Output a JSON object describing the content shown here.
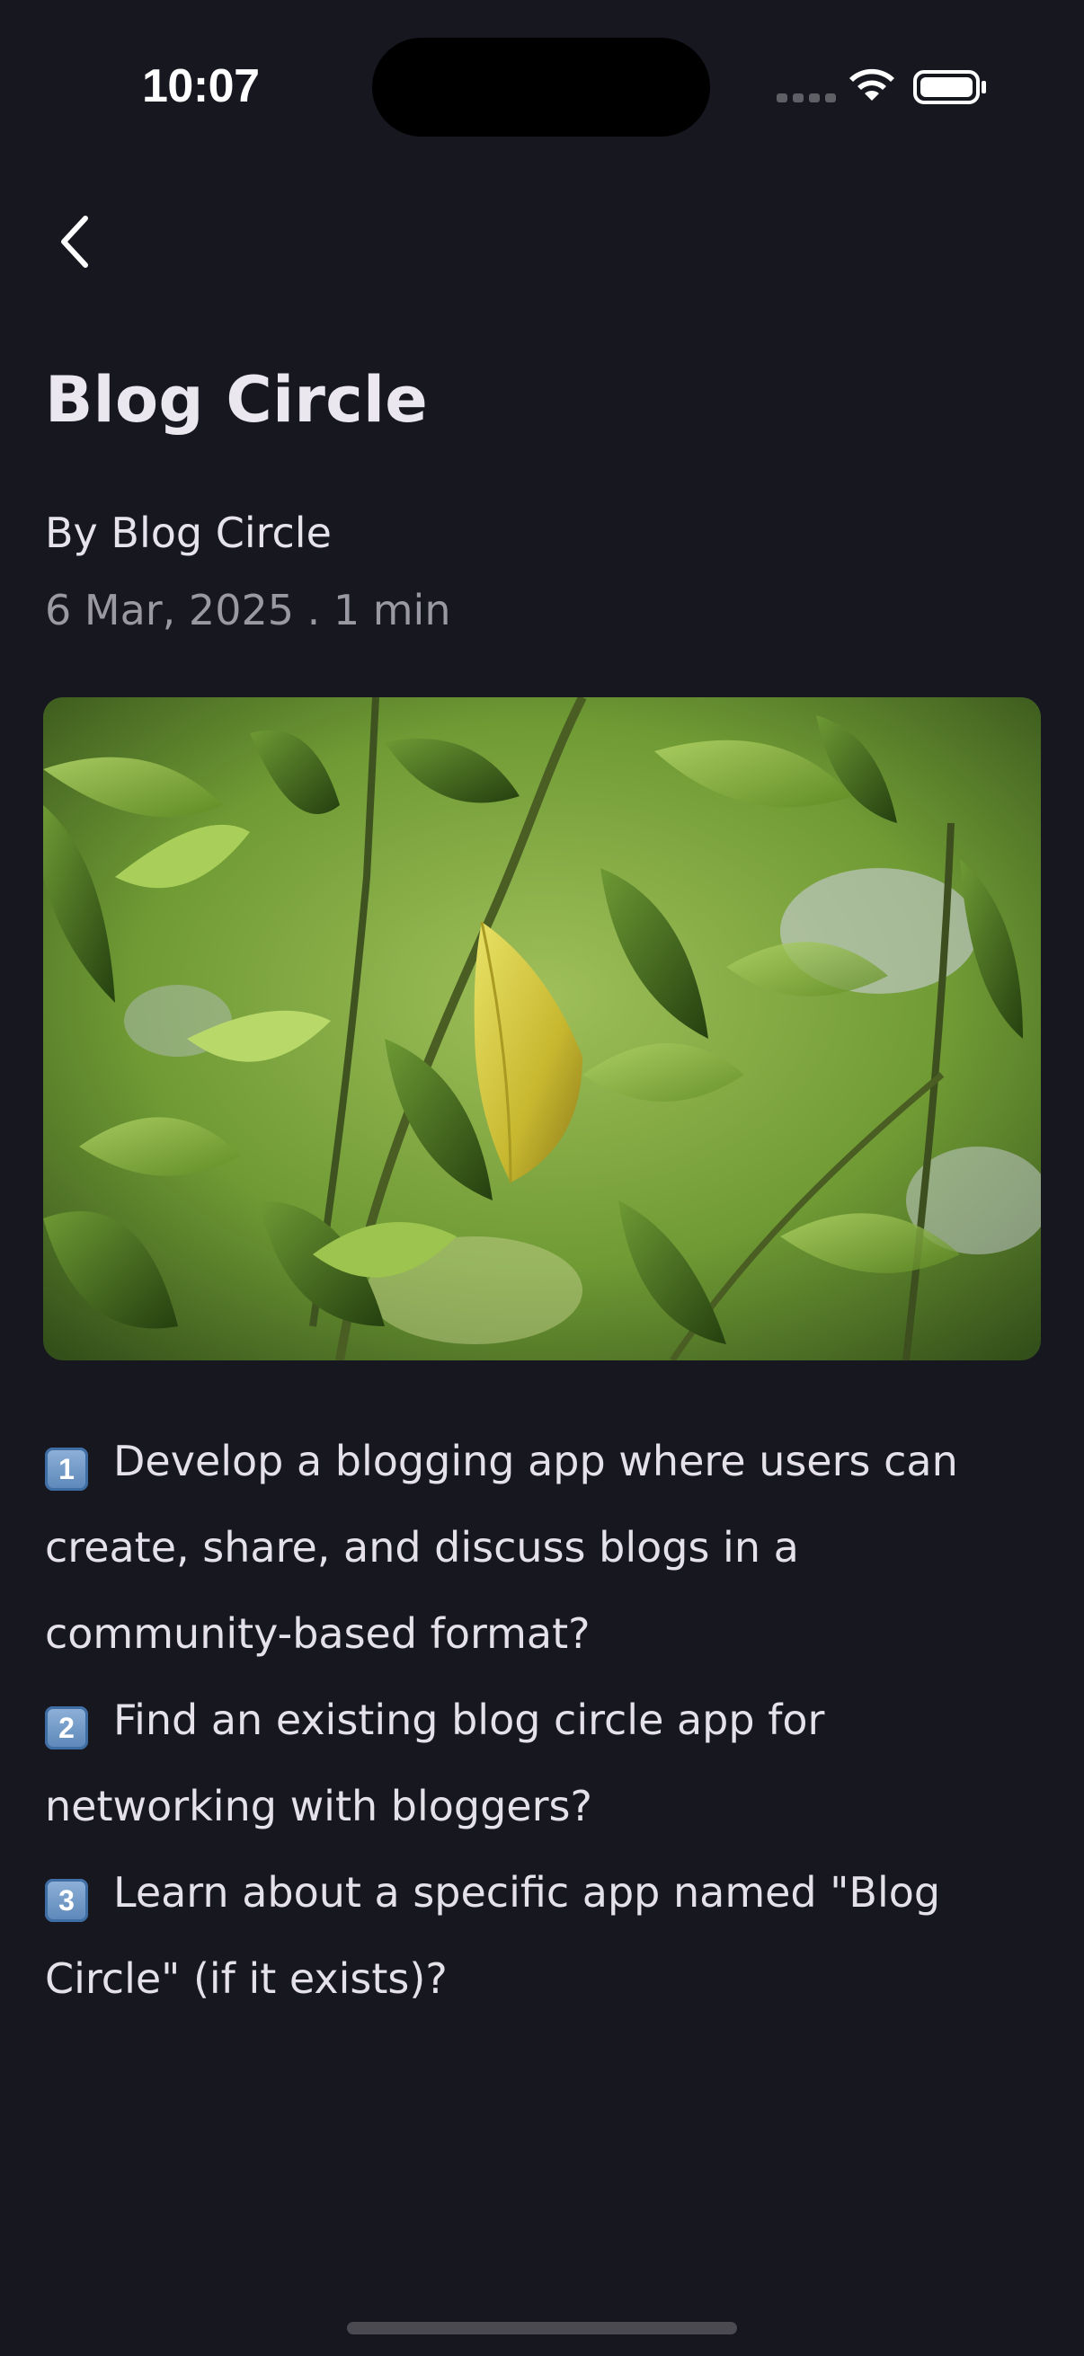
{
  "status_bar": {
    "time": "10:07"
  },
  "nav": {
    "back_icon": "chevron-left-icon"
  },
  "post": {
    "title": "Blog Circle",
    "author": "By Blog Circle",
    "meta": "6 Mar, 2025 . 1 min",
    "items": [
      {
        "num": "1",
        "text": "Develop a blogging app where users can create, share, and discuss blogs in a community-based format?"
      },
      {
        "num": "2",
        "text": "Find an existing blog circle app for networking with bloggers?"
      },
      {
        "num": "3",
        "text": "Learn about a specific app named \"Blog Circle\" (if it exists)?"
      }
    ]
  },
  "colors": {
    "background": "#171720",
    "text": "#e9e6ee",
    "muted": "#9a98a2"
  }
}
